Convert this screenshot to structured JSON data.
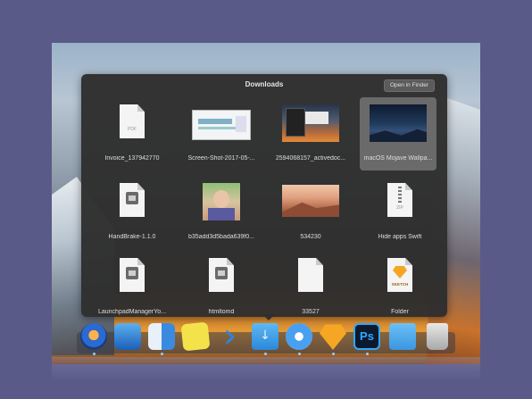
{
  "downloads": {
    "title": "Downloads",
    "open_button": "Open in Finder",
    "items": [
      {
        "label": "Invoice_137942770",
        "icon": "pdf-file-icon",
        "tag": "PDF"
      },
      {
        "label": "Screen-Shot-2017-05-...",
        "icon": "screenshot-thumbnail"
      },
      {
        "label": "2594068157_activedoc...",
        "icon": "sierra-screenshot-thumbnail"
      },
      {
        "label": "macOS Mojave Wallpa...",
        "icon": "mojave-wallpaper-thumbnail",
        "selected": true
      },
      {
        "label": "HandBrake-1.1.0",
        "icon": "dmg-file-icon"
      },
      {
        "label": "b35add3d5bada639f0...",
        "icon": "photo-thumbnail"
      },
      {
        "label": "534230",
        "icon": "desert-wallpaper-thumbnail"
      },
      {
        "label": "Hide apps Swift",
        "icon": "zip-file-icon",
        "tag": "ZIP"
      },
      {
        "label": "LaunchpadManagerYo...",
        "icon": "dmg-file-icon"
      },
      {
        "label": "htmltomd",
        "icon": "dmg-file-icon"
      },
      {
        "label": "33527",
        "icon": "blank-file-icon"
      },
      {
        "label": "Folder",
        "icon": "sketch-file-icon",
        "tag": "SKETCH"
      }
    ]
  },
  "dock": {
    "apps": [
      {
        "name": "launchpad",
        "icon": "launchpad-icon"
      },
      {
        "name": "mission-control",
        "icon": "mission-control-icon"
      },
      {
        "name": "finder",
        "icon": "finder-icon"
      },
      {
        "name": "stickies",
        "icon": "stickies-icon"
      },
      {
        "name": "xcode-arrow",
        "icon": "chevron-right-icon"
      },
      {
        "name": "downloads-stack",
        "icon": "downloads-folder-icon"
      },
      {
        "name": "safari",
        "icon": "safari-icon"
      },
      {
        "name": "sketch",
        "icon": "sketch-icon"
      },
      {
        "name": "photoshop",
        "icon": "photoshop-icon",
        "text": "Ps"
      },
      {
        "name": "folder",
        "icon": "folder-icon"
      },
      {
        "name": "trash",
        "icon": "trash-icon"
      }
    ]
  },
  "colors": {
    "background": "#5a5a88",
    "fan_bg": "#2e2e2e",
    "selected": "#6a6a6a",
    "accent": "#2a86e8"
  }
}
